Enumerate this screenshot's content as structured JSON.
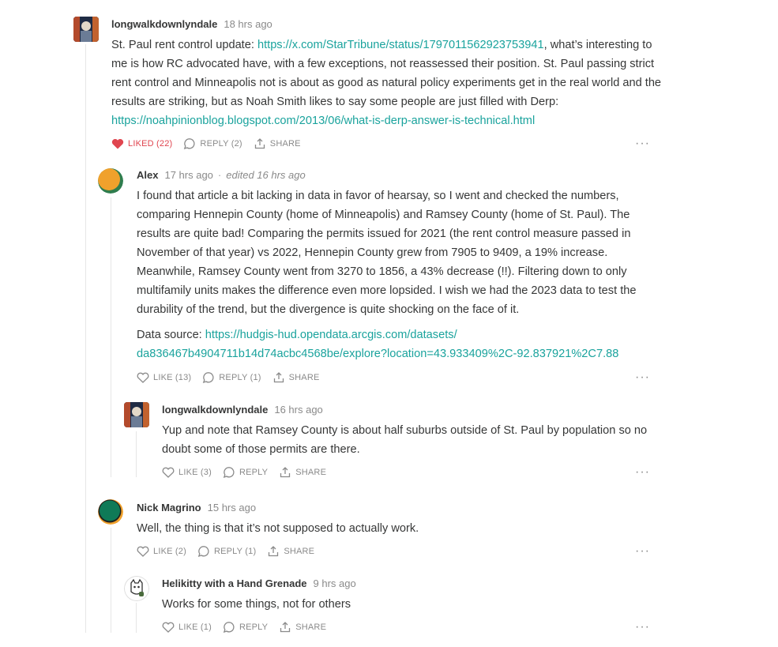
{
  "comments": [
    {
      "author": "longwalkdownlyndale",
      "time": "18 hrs ago",
      "body_pre": "St. Paul rent control update: ",
      "link1": "https://x.com/StarTribune/status/1797011562923753941",
      "body_mid": ", what’s interesting to me is how RC advocated have, with a few exceptions, not reassessed their position. St. Paul passing strict rent control and Minneapolis not is about as good as natural policy experiments get in the real world and the results are striking, but as Noah Smith likes to say some people are just filled with Derp: ",
      "link2": "https://noahpinionblog.blogspot.com/2013/06/what-is-derp-answer-is-technical.html",
      "like_label": "LIKED (22)",
      "reply_label": "REPLY (2)",
      "share_label": "SHARE"
    },
    {
      "author": "Alex",
      "time": "17 hrs ago",
      "separator": "·",
      "edited": "edited 16 hrs ago",
      "para1": "I found that article a bit lacking in data in favor of hearsay, so I went and checked the numbers, comparing Hennepin County (home of Minneapolis) and Ramsey County (home of St. Paul). The results are quite bad! Comparing the permits issued for 2021 (the rent control measure passed in November of that year) vs 2022, Hennepin County grew from 7905 to 9409, a 19% increase. Meanwhile, Ramsey County went from 3270 to 1856, a 43% decrease (!!). Filtering down to only multifamily units makes the difference even more lopsided. I wish we had the 2023 data to test the durability of the trend, but the divergence is quite shocking on the face of it.",
      "para2_pre": "Data source: ",
      "link_line1": "https://hudgis-hud.opendata.arcgis.com/datasets/",
      "link_line2": "da836467b4904711b14d74acbc4568be/explore?location=43.933409%2C-92.837921%2C7.88",
      "like_label": "LIKE (13)",
      "reply_label": "REPLY (1)",
      "share_label": "SHARE"
    },
    {
      "author": "longwalkdownlyndale",
      "time": "16 hrs ago",
      "body": "Yup and note that Ramsey County is about half suburbs outside of St. Paul by population so no doubt some of those permits are there.",
      "like_label": "LIKE (3)",
      "reply_label": "REPLY",
      "share_label": "SHARE"
    },
    {
      "author": "Nick Magrino",
      "time": "15 hrs ago",
      "body": "Well, the thing is that it’s not supposed to actually work.",
      "like_label": "LIKE (2)",
      "reply_label": "REPLY (1)",
      "share_label": "SHARE"
    },
    {
      "author": "Helikitty with a Hand Grenade",
      "time": "9 hrs ago",
      "body": "Works for some things, not for others",
      "like_label": "LIKE (1)",
      "reply_label": "REPLY",
      "share_label": "SHARE"
    }
  ],
  "more_label": "···",
  "colors": {
    "link": "#1aa39d",
    "liked": "#e0454f",
    "muted": "#8a8a8a",
    "text": "#363737",
    "thread": "#e6e6e6"
  },
  "icons": [
    "heart-icon",
    "comment-bubble-icon",
    "share-icon",
    "more-options-icon"
  ]
}
